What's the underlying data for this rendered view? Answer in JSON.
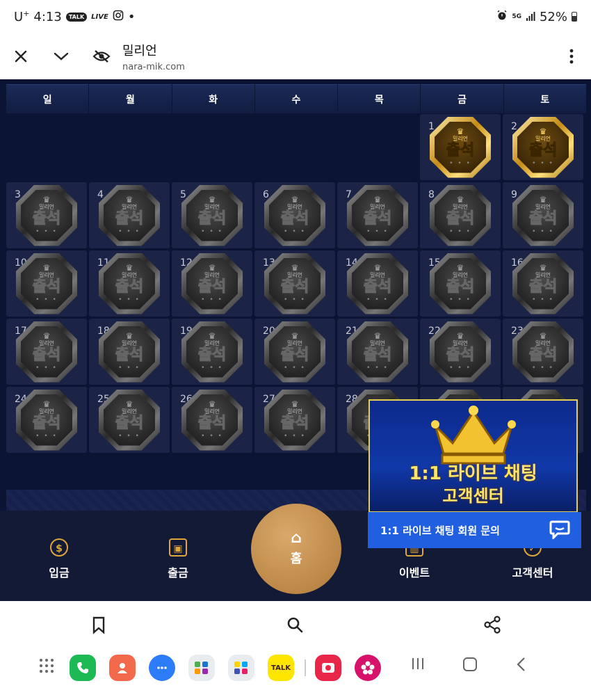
{
  "status_bar": {
    "carrier": "U",
    "carrier_sup": "+",
    "time": "4:13",
    "talk_badge": "TALK",
    "live_label": "LIVE",
    "dot": "•",
    "network": "5G",
    "battery": "52%"
  },
  "browser": {
    "site_title": "밀리언",
    "url": "nara-mik.com"
  },
  "calendar": {
    "weekdays": [
      "일",
      "월",
      "화",
      "수",
      "목",
      "금",
      "토"
    ],
    "badge_word": "출석",
    "badge_brand": "밀리언",
    "badge_dots": "• • •",
    "cells": [
      {
        "num": ""
      },
      {
        "num": ""
      },
      {
        "num": ""
      },
      {
        "num": ""
      },
      {
        "num": ""
      },
      {
        "num": "1"
      },
      {
        "num": "2"
      },
      {
        "num": "3"
      },
      {
        "num": "4"
      },
      {
        "num": "5"
      },
      {
        "num": "6"
      },
      {
        "num": "7"
      },
      {
        "num": "8"
      },
      {
        "num": "9"
      },
      {
        "num": "10"
      },
      {
        "num": "11"
      },
      {
        "num": "12"
      },
      {
        "num": "13"
      },
      {
        "num": "14"
      },
      {
        "num": "15"
      },
      {
        "num": "16"
      },
      {
        "num": "17"
      },
      {
        "num": "18"
      },
      {
        "num": "19"
      },
      {
        "num": "20"
      },
      {
        "num": "21"
      },
      {
        "num": "22"
      },
      {
        "num": "23"
      },
      {
        "num": "24"
      },
      {
        "num": "25"
      },
      {
        "num": "26"
      },
      {
        "num": "27"
      },
      {
        "num": "28"
      },
      {
        "num": ""
      },
      {
        "num": ""
      }
    ],
    "attended_days": [
      "1",
      "2"
    ]
  },
  "nav": {
    "deposit": "입금",
    "withdraw": "출금",
    "home": "홈",
    "event": "이벤트",
    "support": "고객센터"
  },
  "popup": {
    "title": "1:1 라이브 채팅",
    "subtitle": "고객센터",
    "chat_label": "1:1 라이브 채팅 회원 문의"
  },
  "dock": {
    "kakao_label": "TALK"
  },
  "colors": {
    "page_bg": "#0c1433",
    "accent_gold": "#e0a63a",
    "chat_blue": "#1f5fe0",
    "popup_text": "#ffe66a"
  }
}
